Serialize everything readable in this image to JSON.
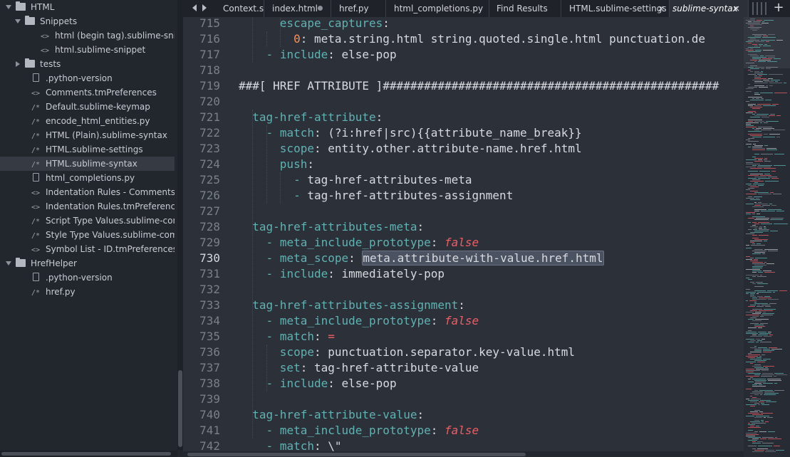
{
  "sidebar": {
    "items": [
      {
        "label": "HTML",
        "kind": "folder",
        "state": "open",
        "level": 0
      },
      {
        "label": "Snippets",
        "kind": "folder",
        "state": "open",
        "level": 1
      },
      {
        "label": "html (begin tag).sublime-snippet",
        "kind": "file",
        "icon": "code-icon",
        "level": 2
      },
      {
        "label": "html.sublime-snippet",
        "kind": "file",
        "icon": "code-icon",
        "level": 2
      },
      {
        "label": "tests",
        "kind": "folder",
        "state": "closed",
        "level": 1
      },
      {
        "label": ".python-version",
        "kind": "file",
        "icon": "file-icon",
        "level": 1
      },
      {
        "label": "Comments.tmPreferences",
        "kind": "file",
        "icon": "code-icon",
        "level": 1
      },
      {
        "label": "Default.sublime-keymap",
        "kind": "file",
        "icon": "comment-icon",
        "level": 1
      },
      {
        "label": "encode_html_entities.py",
        "kind": "file",
        "icon": "comment-icon",
        "level": 1
      },
      {
        "label": "HTML (Plain).sublime-syntax",
        "kind": "file",
        "icon": "comment-icon",
        "level": 1
      },
      {
        "label": "HTML.sublime-settings",
        "kind": "file",
        "icon": "comment-icon",
        "level": 1
      },
      {
        "label": "HTML.sublime-syntax",
        "kind": "file",
        "icon": "comment-icon",
        "level": 1,
        "selected": true
      },
      {
        "label": "html_completions.py",
        "kind": "file",
        "icon": "file-icon",
        "level": 1
      },
      {
        "label": "Indentation Rules - Comments.tmPr",
        "kind": "file",
        "icon": "code-icon",
        "level": 1
      },
      {
        "label": "Indentation Rules.tmPreferences",
        "kind": "file",
        "icon": "code-icon",
        "level": 1
      },
      {
        "label": "Script Type Values.sublime-complet",
        "kind": "file",
        "icon": "comment-icon",
        "level": 1
      },
      {
        "label": "Style Type Values.sublime-completio",
        "kind": "file",
        "icon": "comment-icon",
        "level": 1
      },
      {
        "label": "Symbol List - ID.tmPreferences",
        "kind": "file",
        "icon": "code-icon",
        "level": 1
      },
      {
        "label": "HrefHelper",
        "kind": "folder",
        "state": "open",
        "level": 0
      },
      {
        "label": ".python-version",
        "kind": "file",
        "icon": "file-icon",
        "level": 1
      },
      {
        "label": "href.py",
        "kind": "file",
        "icon": "comment-icon",
        "level": 1
      }
    ]
  },
  "tabs": [
    {
      "label": "Context.sub",
      "active": false
    },
    {
      "label": "index.html",
      "active": false,
      "dirty": true
    },
    {
      "label": "href.py",
      "active": false
    },
    {
      "label": "html_completions.py",
      "active": false
    },
    {
      "label": "Find Results",
      "active": false
    },
    {
      "label": "HTML.sublime-settings",
      "active": false,
      "close": "×"
    },
    {
      "label": "sublime-syntax",
      "active": true,
      "close": "×"
    }
  ],
  "tabbar": {
    "new_tab": "+"
  },
  "editor": {
    "current_line": 730,
    "lines": [
      {
        "n": "715",
        "tokens": [
          {
            "t": "      "
          },
          {
            "t": "escape_captures",
            "c": "key"
          },
          {
            "t": ":"
          }
        ]
      },
      {
        "n": "716",
        "tokens": [
          {
            "t": "        "
          },
          {
            "t": "0",
            "c": "num"
          },
          {
            "t": ": meta.string.html string.quoted.single.html punctuation.de"
          }
        ]
      },
      {
        "n": "717",
        "tokens": [
          {
            "t": "    "
          },
          {
            "t": "-",
            "c": "dash"
          },
          {
            "t": " "
          },
          {
            "t": "include",
            "c": "key"
          },
          {
            "t": ": else-pop"
          }
        ]
      },
      {
        "n": "718",
        "tokens": []
      },
      {
        "n": "719",
        "tokens": [
          {
            "t": "###[ HREF ATTRIBUTE ]#################################################"
          }
        ]
      },
      {
        "n": "720",
        "tokens": []
      },
      {
        "n": "721",
        "tokens": [
          {
            "t": "  "
          },
          {
            "t": "tag-href-attribute",
            "c": "key"
          },
          {
            "t": ":"
          }
        ]
      },
      {
        "n": "722",
        "tokens": [
          {
            "t": "    "
          },
          {
            "t": "-",
            "c": "dash"
          },
          {
            "t": " "
          },
          {
            "t": "match",
            "c": "key"
          },
          {
            "t": ": (?i:href|src){{attribute_name_break}}"
          }
        ]
      },
      {
        "n": "723",
        "tokens": [
          {
            "t": "      "
          },
          {
            "t": "scope",
            "c": "key"
          },
          {
            "t": ": entity.other.attribute-name.href.html"
          }
        ]
      },
      {
        "n": "724",
        "tokens": [
          {
            "t": "      "
          },
          {
            "t": "push",
            "c": "key"
          },
          {
            "t": ":"
          }
        ]
      },
      {
        "n": "725",
        "tokens": [
          {
            "t": "        "
          },
          {
            "t": "-",
            "c": "dash"
          },
          {
            "t": " tag-href-attributes-meta"
          }
        ]
      },
      {
        "n": "726",
        "tokens": [
          {
            "t": "        "
          },
          {
            "t": "-",
            "c": "dash"
          },
          {
            "t": " tag-href-attributes-assignment"
          }
        ]
      },
      {
        "n": "727",
        "tokens": []
      },
      {
        "n": "728",
        "tokens": [
          {
            "t": "  "
          },
          {
            "t": "tag-href-attributes-meta",
            "c": "key"
          },
          {
            "t": ":"
          }
        ]
      },
      {
        "n": "729",
        "tokens": [
          {
            "t": "    "
          },
          {
            "t": "-",
            "c": "dash"
          },
          {
            "t": " "
          },
          {
            "t": "meta_include_prototype",
            "c": "key"
          },
          {
            "t": ": "
          },
          {
            "t": "false",
            "c": "bool"
          }
        ]
      },
      {
        "n": "730",
        "tokens": [
          {
            "t": "    "
          },
          {
            "t": "-",
            "c": "dash"
          },
          {
            "t": " "
          },
          {
            "t": "meta_scope",
            "c": "key"
          },
          {
            "t": ": "
          },
          {
            "t": "meta.attribute-with-value.href.html",
            "c": "sel"
          }
        ]
      },
      {
        "n": "731",
        "tokens": [
          {
            "t": "    "
          },
          {
            "t": "-",
            "c": "dash"
          },
          {
            "t": " "
          },
          {
            "t": "include",
            "c": "key"
          },
          {
            "t": ": immediately-pop"
          }
        ]
      },
      {
        "n": "732",
        "tokens": []
      },
      {
        "n": "733",
        "tokens": [
          {
            "t": "  "
          },
          {
            "t": "tag-href-attributes-assignment",
            "c": "key"
          },
          {
            "t": ":"
          }
        ]
      },
      {
        "n": "734",
        "tokens": [
          {
            "t": "    "
          },
          {
            "t": "-",
            "c": "dash"
          },
          {
            "t": " "
          },
          {
            "t": "meta_include_prototype",
            "c": "key"
          },
          {
            "t": ": "
          },
          {
            "t": "false",
            "c": "bool"
          }
        ]
      },
      {
        "n": "735",
        "tokens": [
          {
            "t": "    "
          },
          {
            "t": "-",
            "c": "dash"
          },
          {
            "t": " "
          },
          {
            "t": "match",
            "c": "key"
          },
          {
            "t": ": "
          },
          {
            "t": "=",
            "c": "eq"
          }
        ]
      },
      {
        "n": "736",
        "tokens": [
          {
            "t": "      "
          },
          {
            "t": "scope",
            "c": "key"
          },
          {
            "t": ": punctuation.separator.key-value.html"
          }
        ]
      },
      {
        "n": "737",
        "tokens": [
          {
            "t": "      "
          },
          {
            "t": "set",
            "c": "key"
          },
          {
            "t": ": tag-href-attribute-value"
          }
        ]
      },
      {
        "n": "738",
        "tokens": [
          {
            "t": "    "
          },
          {
            "t": "-",
            "c": "dash"
          },
          {
            "t": " "
          },
          {
            "t": "include",
            "c": "key"
          },
          {
            "t": ": else-pop"
          }
        ]
      },
      {
        "n": "739",
        "tokens": []
      },
      {
        "n": "740",
        "tokens": [
          {
            "t": "  "
          },
          {
            "t": "tag-href-attribute-value",
            "c": "key"
          },
          {
            "t": ":"
          }
        ]
      },
      {
        "n": "741",
        "tokens": [
          {
            "t": "    "
          },
          {
            "t": "-",
            "c": "dash"
          },
          {
            "t": " "
          },
          {
            "t": "meta_include_prototype",
            "c": "key"
          },
          {
            "t": ": "
          },
          {
            "t": "false",
            "c": "bool"
          }
        ]
      },
      {
        "n": "742",
        "tokens": [
          {
            "t": "    "
          },
          {
            "t": "-",
            "c": "dash"
          },
          {
            "t": " "
          },
          {
            "t": "match",
            "c": "key"
          },
          {
            "t": ": \\\""
          }
        ]
      }
    ]
  },
  "colors": {
    "background": "#2b3039",
    "sidebar": "#22262d",
    "key": "#5fb3b3",
    "bool": "#ec5f67",
    "number": "#f99157",
    "text": "#d8dadf"
  }
}
